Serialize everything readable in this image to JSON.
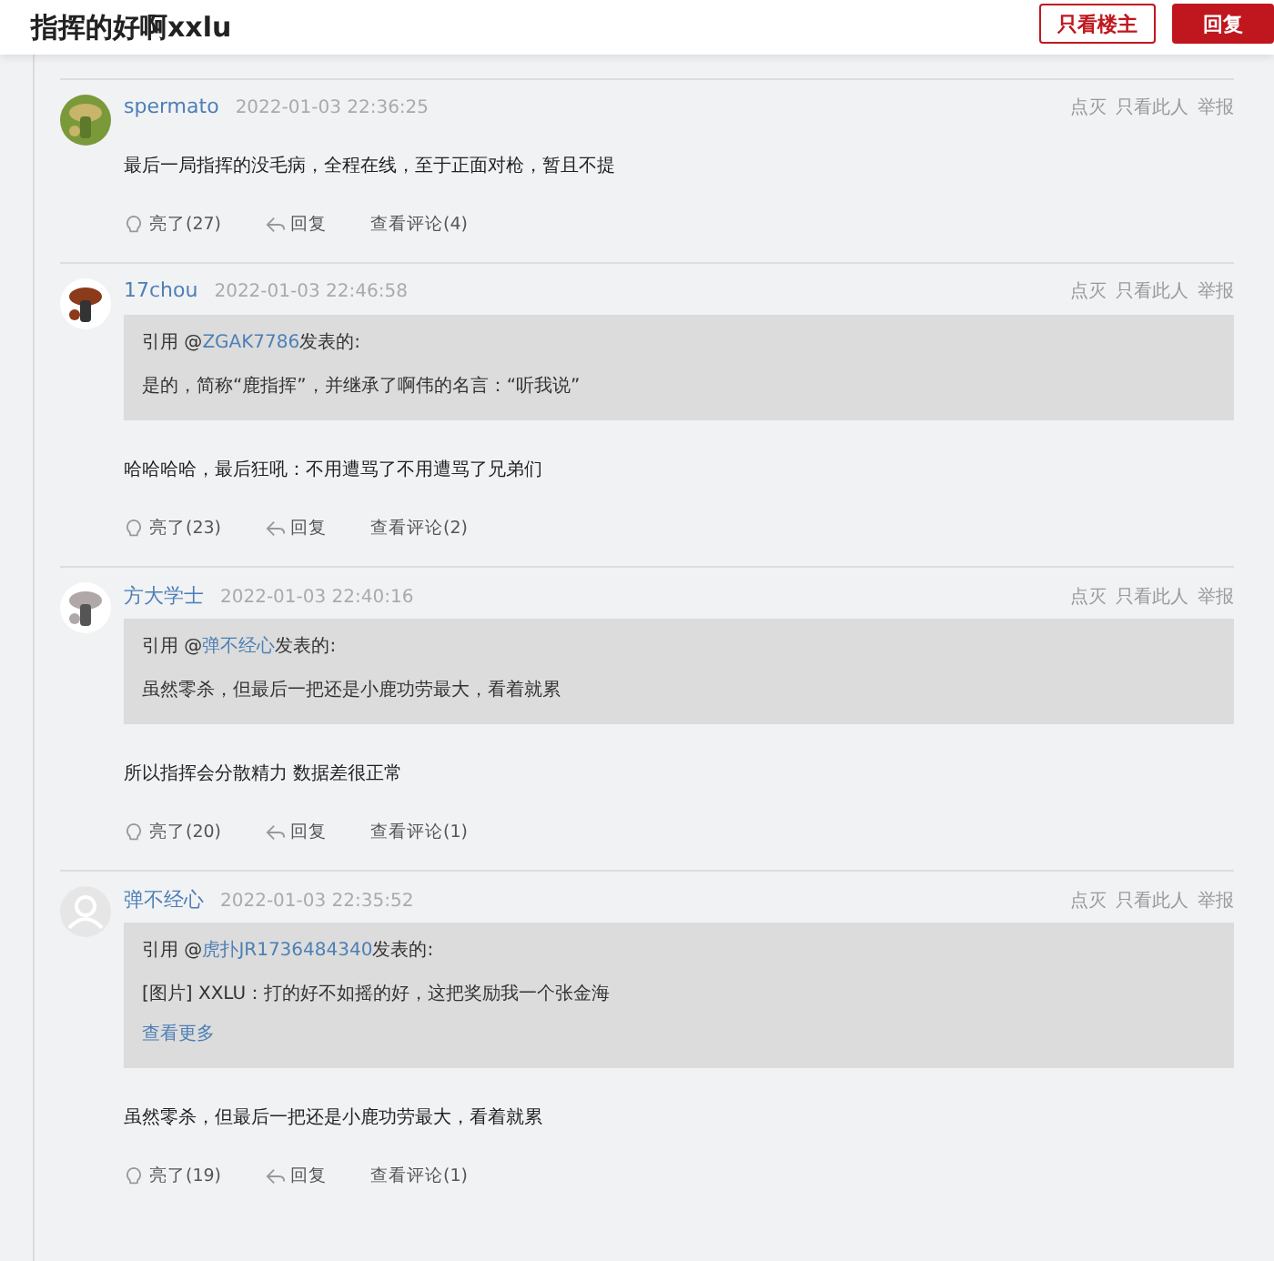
{
  "header": {
    "title": "指挥的好啊xxlu",
    "buttons": [
      {
        "label": "只看楼主",
        "kind": "outline"
      },
      {
        "label": "回复",
        "kind": "primary"
      }
    ]
  },
  "posts": [
    {
      "avatar": {
        "kind": "picture"
      },
      "user": "spermato",
      "time": "2022-01-03 22:36:25",
      "actions": [
        "点灭",
        "只看此人",
        "举报"
      ],
      "body": "最后一局指挥的没毛病，全程在线，至于正面对枪，暂且不提",
      "likes": "亮了(27)",
      "reply": "回复",
      "comments": "查看评论(4)"
    },
    {
      "avatar": {
        "kind": "picture"
      },
      "user": "17chou",
      "time": "2022-01-03 22:46:58",
      "actions": [
        "点灭",
        "只看此人",
        "举报"
      ],
      "quote": {
        "prefix": "引用 @",
        "author": "ZGAK7786",
        "suffix": "发表的:",
        "text": "是的，简称“鹿指挥”，并继承了啊伟的名言：“听我说”"
      },
      "body": "哈哈哈哈，最后狂吼：不用遭骂了不用遭骂了兄弟们",
      "likes": "亮了(23)",
      "reply": "回复",
      "comments": "查看评论(2)"
    },
    {
      "avatar": {
        "kind": "picture"
      },
      "user": "方大学士",
      "time": "2022-01-03 22:40:16",
      "actions": [
        "点灭",
        "只看此人",
        "举报"
      ],
      "quote": {
        "prefix": "引用 @",
        "author": "弹不经心",
        "suffix": "发表的:",
        "text": "虽然零杀，但最后一把还是小鹿功劳最大，看着就累"
      },
      "body": "所以指挥会分散精力 数据差很正常",
      "likes": "亮了(20)",
      "reply": "回复",
      "comments": "查看评论(1)"
    },
    {
      "avatar": {
        "kind": "default"
      },
      "user": "弹不经心",
      "time": "2022-01-03 22:35:52",
      "actions": [
        "点灭",
        "只看此人",
        "举报"
      ],
      "quote": {
        "prefix": "引用 @",
        "author": "虎扑JR1736484340",
        "suffix": "发表的:",
        "text": "[图片] XXLU：打的好不如摇的好，这把奖励我一个张金海",
        "more": "查看更多"
      },
      "body": "虽然零杀，但最后一把还是小鹿功劳最大，看着就累",
      "likes": "亮了(19)",
      "reply": "回复",
      "comments": "查看评论(1)"
    }
  ]
}
